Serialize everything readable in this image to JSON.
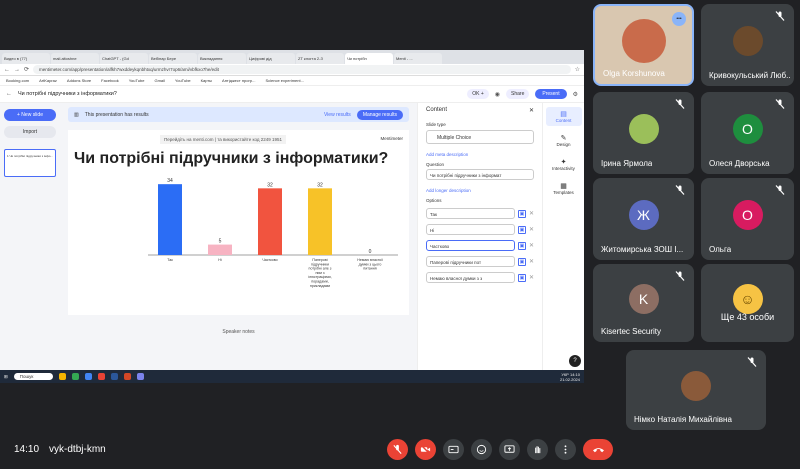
{
  "browser": {
    "tabs": [
      "Видео в (77)",
      "mail.altoshnе",
      "ChatGPT - (Gd",
      "Вебінар Бере",
      "Викладання",
      "Цифрові дід",
      "ZT клогта 2-З",
      "Чи потрібн",
      "Menti - ..."
    ],
    "url": "mentimeter.com/app/presentation/alfkh7wxddeykqnbhtxq/urmzhvr7op6/ami/vbfkxo7he/edit",
    "bookmarks": [
      "Booking.com",
      "ArtKapraz",
      "Addons Store",
      "Facebook",
      "YouTube",
      "Gmail",
      "YouTube",
      "Карты",
      "Антіджест прогр...",
      "Science experiment..."
    ]
  },
  "menti": {
    "title": "Чи потрібні підручники з інформатики?",
    "ok_label": "OK +",
    "share_label": "Share",
    "present_label": "Present",
    "new_slide_label": "+ New slide",
    "import_label": "Import",
    "thumb_title": "Чи потрібні підручники з інфо...",
    "thumb_num": "1",
    "notice": "This presentation has results",
    "view_results": "View results",
    "manage_results": "Manage results",
    "join_code": "Перейдіть на menti.com | та використайте код  2249 1951",
    "logo": "Mentimeter",
    "speaker_notes": "Speaker notes"
  },
  "panel": {
    "title": "Content",
    "slide_type_label": "Slide type",
    "slide_type": "Multiple Choice",
    "add_meta": "Add meta description",
    "question_label": "Question",
    "question_value": "Чи потрібні підручники з інформат",
    "add_longer": "Add longer description",
    "options_label": "Options",
    "options": [
      "Так",
      "Ні",
      "Частково",
      "Паперові підручники пот",
      "Немаю власної думки з з"
    ],
    "rail": [
      "Content",
      "Design",
      "Interactivity",
      "Templates"
    ]
  },
  "taskbar": {
    "search": "Пошук",
    "time": "14:10",
    "date": "21.02.2024",
    "lang": "УКР"
  },
  "chart_data": {
    "type": "bar",
    "title": "Чи потрібні підручники з інформатики?",
    "categories": [
      "Так",
      "Ні",
      "Частково",
      "Паперові підручники потрібні але з ним з ілюстраціями, порадами, прикладами",
      "Немаю власної думки з цього питання"
    ],
    "values": [
      34,
      5,
      32,
      32,
      0
    ],
    "colors": [
      "#2b6df5",
      "#f7b3c2",
      "#f1543f",
      "#f7c228",
      "#4a6cf7"
    ],
    "ylim": [
      0,
      36
    ]
  },
  "participants": [
    {
      "name": "Olga Korshunova",
      "kind": "photo",
      "color": "#c96b4b"
    },
    {
      "name": "Кривокульський Люб...",
      "kind": "photo",
      "color": "#6b4a2c"
    },
    {
      "name": "Ірина Ярмола",
      "kind": "photo",
      "color": "#9bbf5a"
    },
    {
      "name": "Олеся Дворська",
      "kind": "letter",
      "letter": "О",
      "color": "#1e8e3e"
    },
    {
      "name": "Житомирська ЗОШ І...",
      "kind": "letter",
      "letter": "Ж",
      "color": "#5c6bc0"
    },
    {
      "name": "Ольга",
      "kind": "letter",
      "letter": "О",
      "color": "#d81b60"
    },
    {
      "name": "Kisertec Security",
      "kind": "letter",
      "letter": "K",
      "color": "#8d6e63"
    },
    {
      "name": "Ще 43 особи",
      "kind": "group",
      "color": "#f6c344"
    },
    {
      "name": "Німко Наталія Михайлівна",
      "kind": "photo",
      "color": "#8a5a3a"
    }
  ],
  "meeting": {
    "time": "14:10",
    "code": "vyk-dtbj-kmn"
  },
  "colors": {
    "background": "#202124",
    "tile": "#3c4043",
    "end_call": "#ea4335",
    "accent": "#8ab4f8"
  }
}
